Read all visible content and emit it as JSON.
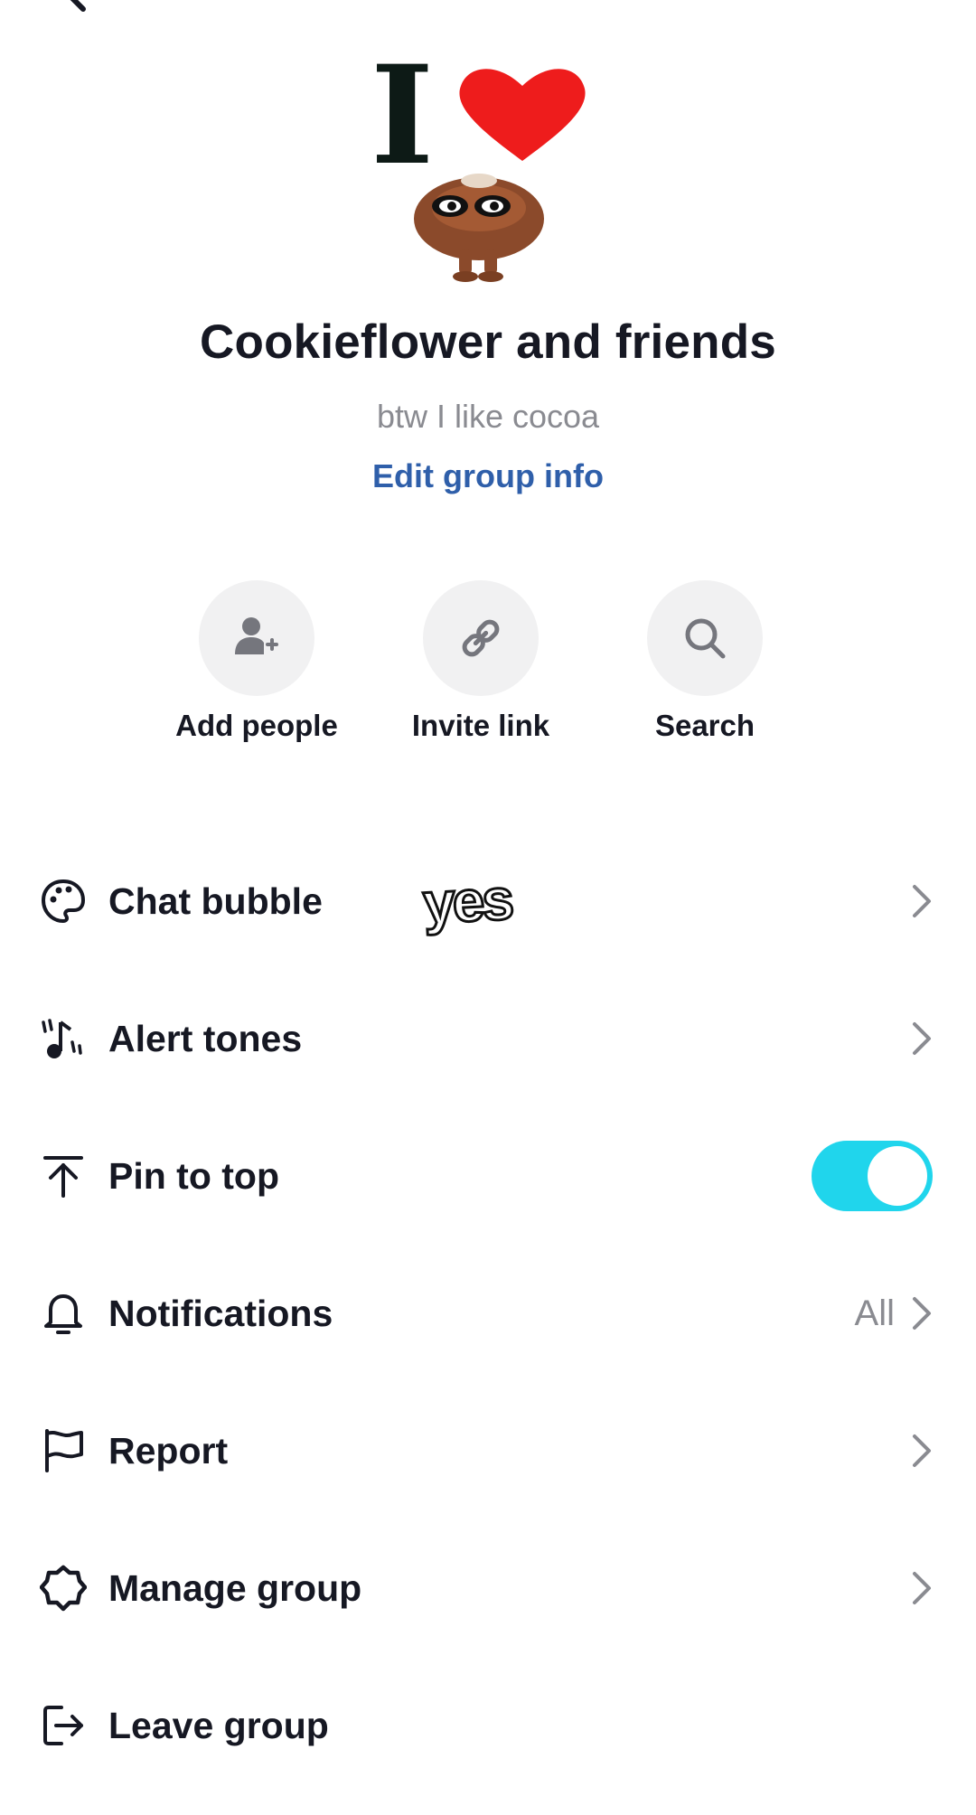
{
  "group": {
    "name": "Cookieflower and friends",
    "description": "btw I like cocoa",
    "edit_label": "Edit group info",
    "avatar_text": "I"
  },
  "actions": [
    {
      "label": "Add people",
      "icon": "add-person-icon"
    },
    {
      "label": "Invite link",
      "icon": "link-icon"
    },
    {
      "label": "Search",
      "icon": "search-icon"
    }
  ],
  "settings": [
    {
      "label": "Chat bubble",
      "icon": "palette-icon",
      "right": "chevron"
    },
    {
      "label": "Alert tones",
      "icon": "music-note-icon",
      "right": "chevron"
    },
    {
      "label": "Pin to top",
      "icon": "pin-to-top-icon",
      "right": "toggle",
      "toggle_on": true
    },
    {
      "label": "Notifications",
      "icon": "bell-icon",
      "right": "chevron",
      "value": "All"
    },
    {
      "label": "Report",
      "icon": "flag-icon",
      "right": "chevron"
    },
    {
      "label": "Manage group",
      "icon": "gear-icon",
      "right": "chevron"
    },
    {
      "label": "Leave group",
      "icon": "exit-icon",
      "right": "none"
    }
  ],
  "sticker_text": "yes",
  "colors": {
    "accent_link": "#2f5faa",
    "toggle_on": "#20d5ec",
    "heart": "#ee1c1c",
    "text_primary": "#161823",
    "text_secondary": "#8a8b91"
  }
}
